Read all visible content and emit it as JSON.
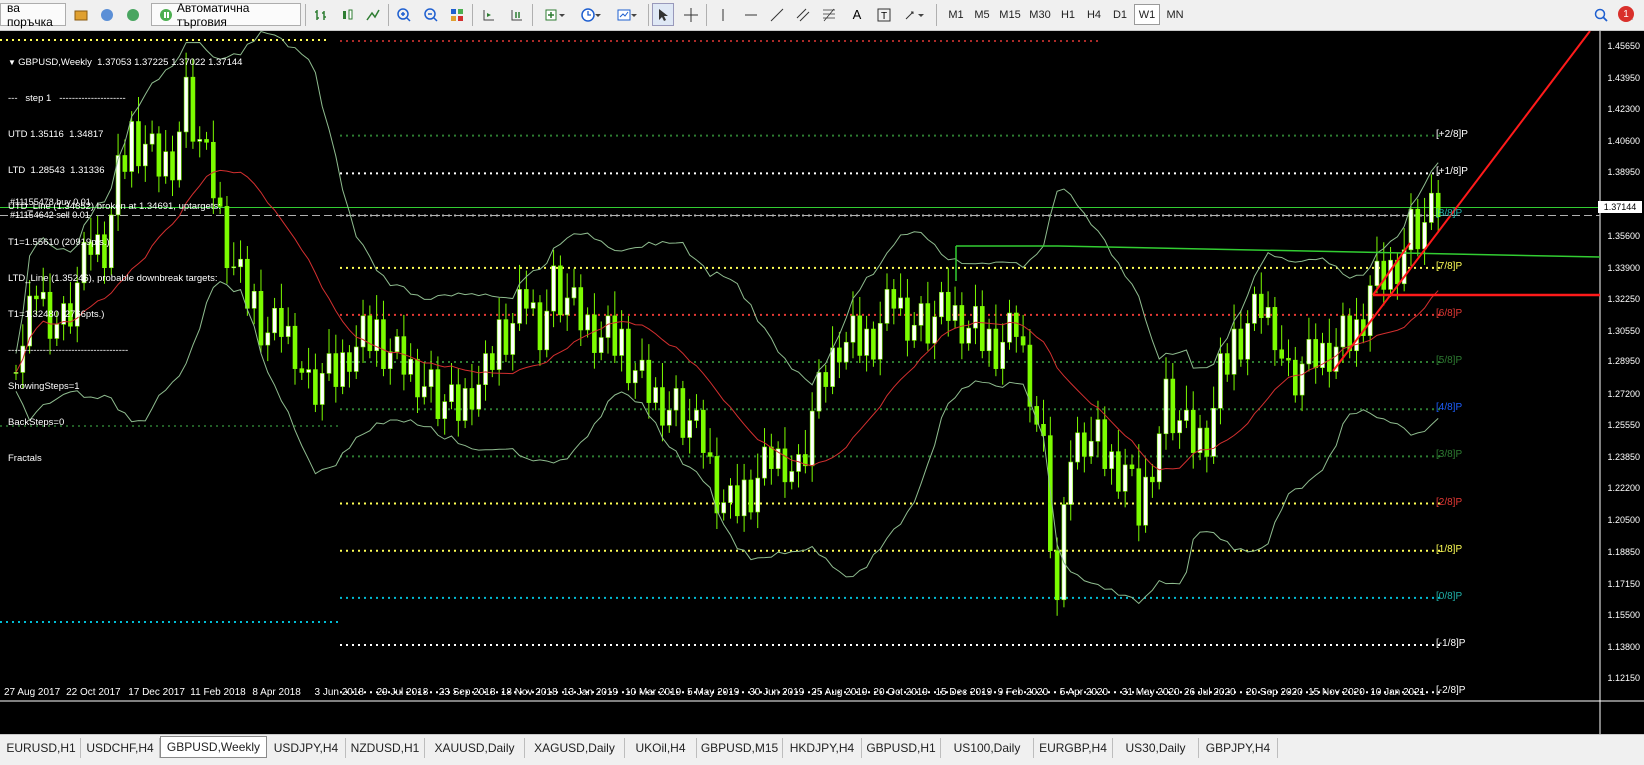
{
  "toolbar": {
    "new_order_label": "ва поръчка",
    "autotrading_label": "Автоматична търговия",
    "timeframes": [
      "M1",
      "M5",
      "M15",
      "M30",
      "H1",
      "H4",
      "D1",
      "W1",
      "MN"
    ],
    "active_timeframe": "W1",
    "alert_count": "1"
  },
  "chart": {
    "title": "GBPUSD,Weekly  1.37053 1.37225 1.37022 1.37144",
    "info_lines": [
      "---   step 1   ---------------------",
      "UTD 1.35116  1.34817",
      "LTD  1.28543  1.31336",
      "UTD_Line (1.34652) broken at 1.34691, uptargets:",
      "T1=1.55610 (20919pts.)",
      "LTD_Line (1.35246), probable downbreak targets:",
      "T1=1.32480 (2766pts.)",
      "--------------------------------------",
      "ShowingSteps=1",
      "BackSteps=0",
      "Fractals"
    ],
    "orders": [
      "#11155478 buy 0.01",
      "#11154642 sell 0.01"
    ],
    "current_price": "1.37144",
    "murrey_levels": [
      {
        "label": "[+2/8]P",
        "price": 1.4095,
        "color": "#ffffff",
        "line": "#2e7d32"
      },
      {
        "label": "[+1/8]P",
        "price": 1.3895,
        "color": "#ffffff",
        "line": "#ffffff"
      },
      {
        "label": "[8/8]P",
        "price": 1.3672,
        "color": "#20b2aa",
        "line": "#b0b0b0"
      },
      {
        "label": "[7/8]P",
        "price": 1.3394,
        "color": "#ffff55",
        "line": "#ffff55"
      },
      {
        "label": "[6/8]P",
        "price": 1.3145,
        "color": "#e53935",
        "line": "#e53935"
      },
      {
        "label": "[5/8]P",
        "price": 1.2895,
        "color": "#2e7d32",
        "line": "#2e7d32"
      },
      {
        "label": "[4/8]P",
        "price": 1.2645,
        "color": "#1e5fff",
        "line": "#2e7d32"
      },
      {
        "label": "[3/8]P",
        "price": 1.2395,
        "color": "#2e7d32",
        "line": "#2e7d32"
      },
      {
        "label": "[2/8]P",
        "price": 1.2145,
        "color": "#e53935",
        "line": "#ffff55"
      },
      {
        "label": "[1/8]P",
        "price": 1.1895,
        "color": "#ffff55",
        "line": "#ffff55"
      },
      {
        "label": "[0/8]P",
        "price": 1.1645,
        "color": "#20b2aa",
        "line": "#00bcd4"
      },
      {
        "label": "[-1/8]P",
        "price": 1.1395,
        "color": "#ffffff",
        "line": "#ffffff"
      },
      {
        "label": "[-2/8]P",
        "price": 1.1145,
        "color": "#ffffff",
        "line": "#ffffff"
      }
    ]
  },
  "price_axis": [
    "1.45650",
    "1.43950",
    "1.42300",
    "1.40600",
    "1.38950",
    "1.37144",
    "1.35600",
    "1.33900",
    "1.32250",
    "1.30550",
    "1.28950",
    "1.27200",
    "1.25550",
    "1.23850",
    "1.22200",
    "1.20500",
    "1.18850",
    "1.17150",
    "1.15500",
    "1.13800",
    "1.12150"
  ],
  "date_axis": [
    "27 Aug 2017",
    "22 Oct 2017",
    "17 Dec 2017",
    "11 Feb 2018",
    "8 Apr 2018",
    "3 Jun 2018",
    "29 Jul 2018",
    "23 Sep 2018",
    "18 Nov 2018",
    "13 Jan 2019",
    "10 Mar 2019",
    "5 May 2019",
    "30 Jun 2019",
    "25 Aug 2019",
    "20 Oct 2019",
    "15 Dec 2019",
    "9 Feb 2020",
    "5 Apr 2020",
    "31 May 2020",
    "26 Jul 2020",
    "20 Sep 2020",
    "15 Nov 2020",
    "10 Jan 2021"
  ],
  "tabs": [
    "EURUSD,H1",
    "USDCHF,H4",
    "GBPUSD,Weekly",
    "USDJPY,H4",
    "NZDUSD,H1",
    "XAUUSD,Daily",
    "XAGUSD,Daily",
    "UKOil,H4",
    "GBPUSD,M15",
    "HKDJPY,H4",
    "GBPUSD,H1",
    "US100,Daily",
    "EURGBP,H4",
    "US30,Daily",
    "GBPJPY,H4"
  ],
  "active_tab": "GBPUSD,Weekly",
  "colors": {
    "bull": "#ffffff",
    "bear": "#7cfc00",
    "bands": "#8fbc8f",
    "ma": "#d32f2f",
    "trend": "#ff1a1a",
    "supply": "#32cd32"
  },
  "chart_data": {
    "type": "candlestick",
    "title": "GBPUSD,Weekly",
    "ohlc_last": [
      1.37053,
      1.37225,
      1.37022,
      1.37144
    ],
    "ylim": [
      1.1215,
      1.4565
    ],
    "close_trend": [
      1.298,
      1.33,
      1.316,
      1.31,
      1.328,
      1.35,
      1.35,
      1.385,
      1.41,
      1.405,
      1.395,
      1.4,
      1.43,
      1.404,
      1.38,
      1.35,
      1.33,
      1.32,
      1.305,
      1.31,
      1.3,
      1.275,
      1.28,
      1.28,
      1.295,
      1.3,
      1.305,
      1.295,
      1.29,
      1.285,
      1.275,
      1.265,
      1.262,
      1.275,
      1.28,
      1.305,
      1.31,
      1.325,
      1.31,
      1.33,
      1.32,
      1.31,
      1.305,
      1.3,
      1.3,
      1.285,
      1.275,
      1.27,
      1.265,
      1.255,
      1.245,
      1.22,
      1.21,
      1.22,
      1.228,
      1.24,
      1.24,
      1.23,
      1.26,
      1.28,
      1.3,
      1.3,
      1.3,
      1.31,
      1.325,
      1.315,
      1.31,
      1.31,
      1.315,
      1.31,
      1.305,
      1.3,
      1.3,
      1.31,
      1.28,
      1.24,
      1.16,
      1.24,
      1.25,
      1.245,
      1.235,
      1.235,
      1.21,
      1.24,
      1.27,
      1.255,
      1.245,
      1.25,
      1.28,
      1.3,
      1.31,
      1.32,
      1.31,
      1.28,
      1.285,
      1.29,
      1.295,
      1.3,
      1.305,
      1.33,
      1.335,
      1.345,
      1.36,
      1.36,
      1.37
    ]
  }
}
